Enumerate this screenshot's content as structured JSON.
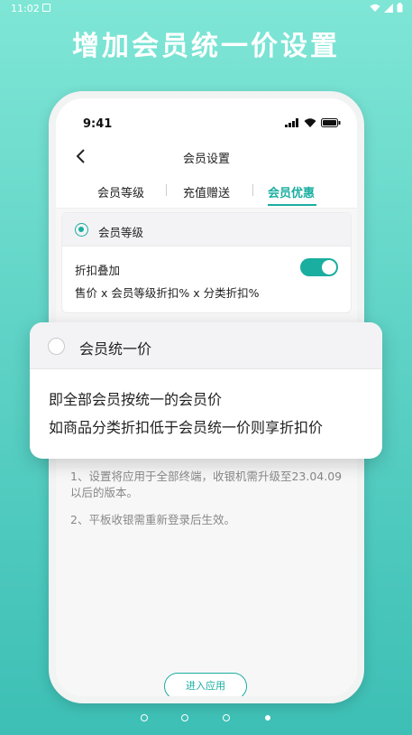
{
  "statusbar": {
    "time": "11:02"
  },
  "banner": {
    "title": "增加会员统一价设置"
  },
  "phone": {
    "time": "9:41",
    "nav_title": "会员设置",
    "tabs": [
      {
        "label": "会员等级"
      },
      {
        "label": "充值赠送"
      },
      {
        "label": "会员优惠"
      }
    ],
    "card": {
      "option_label": "会员等级",
      "stack_label": "折扣叠加",
      "stack_enabled": true,
      "formula": "售价 x 会员等级折扣% x 分类折扣%"
    },
    "notes": [
      "1、设置将应用于全部终端，收银机需升级至23.04.09以后的版本。",
      "2、平板收银需重新登录后生效。"
    ],
    "enter_button": "进入应用"
  },
  "popup": {
    "option_label": "会员统一价",
    "line1": "即全部会员按统一的会员价",
    "line2": "如商品分类折扣低于会员统一价则享折扣价"
  },
  "pager": {
    "count": 4,
    "active_index": 3
  },
  "colors": {
    "accent": "#1aaea0",
    "background_top": "#7fe6d6",
    "background_bottom": "#3dbfb5"
  }
}
